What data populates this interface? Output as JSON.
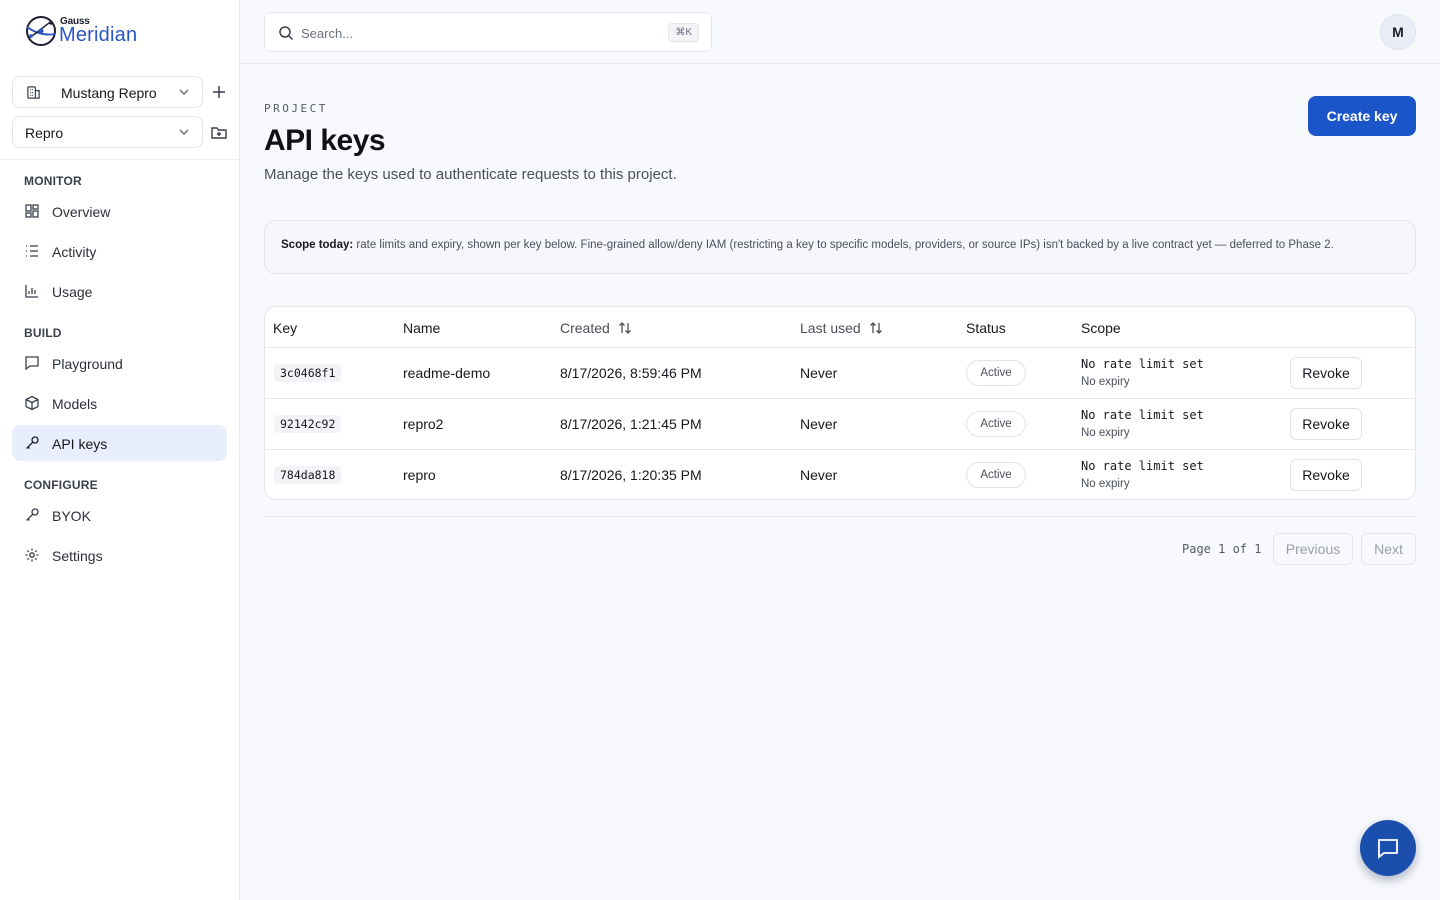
{
  "brand": {
    "small": "Gauss",
    "name": "Meridian"
  },
  "org_selector": {
    "value": "Mustang Repro"
  },
  "project_selector": {
    "value": "Repro"
  },
  "sidebar": {
    "sections": [
      {
        "label": "MONITOR",
        "items": [
          "Overview",
          "Activity",
          "Usage"
        ]
      },
      {
        "label": "BUILD",
        "items": [
          "Playground",
          "Models",
          "API keys"
        ]
      },
      {
        "label": "CONFIGURE",
        "items": [
          "BYOK",
          "Settings"
        ]
      }
    ],
    "active": "API keys"
  },
  "search": {
    "placeholder": "Search...",
    "shortcut": "⌘K"
  },
  "user": {
    "initial": "M"
  },
  "page": {
    "eyebrow": "PROJECT",
    "title": "API keys",
    "subtitle": "Manage the keys used to authenticate requests to this project.",
    "create_label": "Create key"
  },
  "notice": {
    "lead": "Scope today:",
    "text": " rate limits and expiry, shown per key below. Fine-grained allow/deny IAM (restricting a key to specific models, providers, or source IPs) isn't backed by a live contract yet — deferred to Phase 2."
  },
  "table": {
    "columns": [
      "Key",
      "Name",
      "Created",
      "Last used",
      "Status",
      "Scope"
    ],
    "rows": [
      {
        "key": "3c0468f1",
        "name": "readme-demo",
        "created": "8/17/2026, 8:59:46 PM",
        "last_used": "Never",
        "status": "Active",
        "scope_rate": "No rate limit set",
        "scope_expiry": "No expiry",
        "action": "Revoke"
      },
      {
        "key": "92142c92",
        "name": "repro2",
        "created": "8/17/2026, 1:21:45 PM",
        "last_used": "Never",
        "status": "Active",
        "scope_rate": "No rate limit set",
        "scope_expiry": "No expiry",
        "action": "Revoke"
      },
      {
        "key": "784da818",
        "name": "repro",
        "created": "8/17/2026, 1:20:35 PM",
        "last_used": "Never",
        "status": "Active",
        "scope_rate": "No rate limit set",
        "scope_expiry": "No expiry",
        "action": "Revoke"
      }
    ]
  },
  "pagination": {
    "info": "Page 1 of 1",
    "prev": "Previous",
    "next": "Next"
  },
  "colors": {
    "accent": "#1a56c9",
    "fab": "#1a4fae",
    "active_nav": "#e8eefb"
  }
}
